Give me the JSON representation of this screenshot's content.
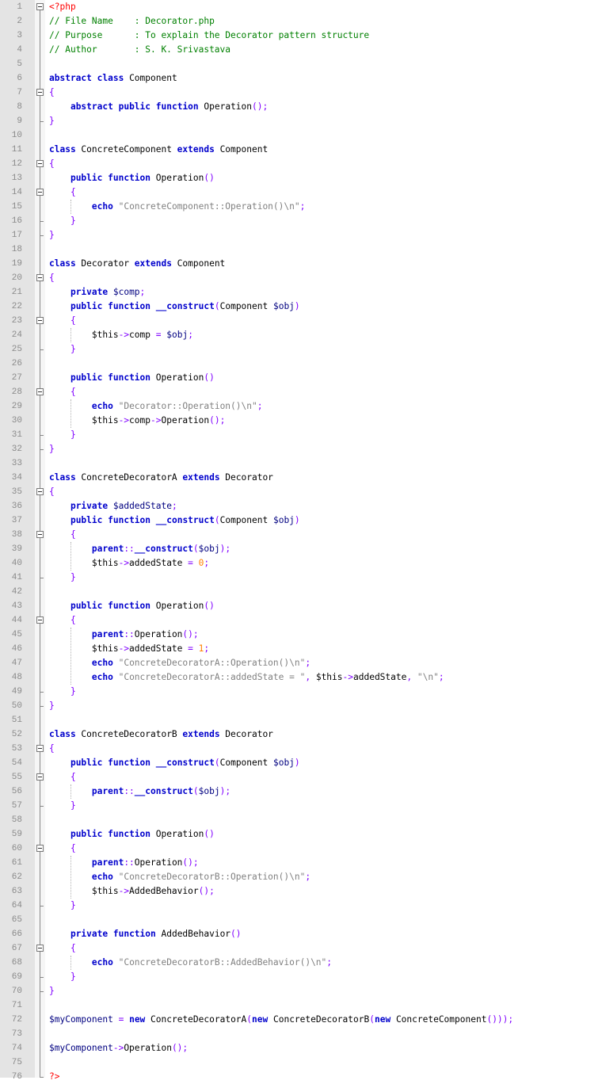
{
  "editor": {
    "language": "php",
    "file_name": "Decorator.php",
    "colors": {
      "keyword": "#0000cc",
      "comment": "#008000",
      "string": "#808080",
      "number": "#ff8000",
      "php_tag": "#ff0000",
      "operator": "#8000ff",
      "variable": "#000080",
      "gutter": "#e4e4e4"
    },
    "lines": [
      "<?php",
      "// File Name    : Decorator.php",
      "// Purpose      : To explain the Decorator pattern structure",
      "// Author       : S. K. Srivastava",
      "",
      "abstract class Component",
      "{",
      "    abstract public function Operation();",
      "}",
      "",
      "class ConcreteComponent extends Component",
      "{",
      "    public function Operation()",
      "    {",
      "        echo \"ConcreteComponent::Operation()\\n\";",
      "    }",
      "}",
      "",
      "class Decorator extends Component",
      "{",
      "    private $comp;",
      "    public function __construct(Component $obj)",
      "    {",
      "        $this->comp = $obj;",
      "    }",
      "",
      "    public function Operation()",
      "    {",
      "        echo \"Decorator::Operation()\\n\";",
      "        $this->comp->Operation();",
      "    }",
      "}",
      "",
      "class ConcreteDecoratorA extends Decorator",
      "{",
      "    private $addedState;",
      "    public function __construct(Component $obj)",
      "    {",
      "        parent::__construct($obj);",
      "        $this->addedState = 0;",
      "    }",
      "",
      "    public function Operation()",
      "    {",
      "        parent::Operation();",
      "        $this->addedState = 1;",
      "        echo \"ConcreteDecoratorA::Operation()\\n\";",
      "        echo \"ConcreteDecoratorA::addedState = \", $this->addedState, \"\\n\";",
      "    }",
      "}",
      "",
      "class ConcreteDecoratorB extends Decorator",
      "{",
      "    public function __construct(Component $obj)",
      "    {",
      "        parent::__construct($obj);",
      "    }",
      "",
      "    public function Operation()",
      "    {",
      "        parent::Operation();",
      "        echo \"ConcreteDecoratorB::Operation()\\n\";",
      "        $this->AddedBehavior();",
      "    }",
      "",
      "    private function AddedBehavior()",
      "    {",
      "        echo \"ConcreteDecoratorB::AddedBehavior()\\n\";",
      "    }",
      "}",
      "",
      "$myComponent = new ConcreteDecoratorA(new ConcreteDecoratorB(new ConcreteComponent()));",
      "",
      "$myComponent->Operation();",
      "",
      "?>"
    ],
    "fold_blocks": [
      [
        1,
        76
      ],
      [
        7,
        9
      ],
      [
        12,
        17
      ],
      [
        14,
        16
      ],
      [
        20,
        32
      ],
      [
        23,
        25
      ],
      [
        28,
        31
      ],
      [
        35,
        50
      ],
      [
        38,
        41
      ],
      [
        44,
        49
      ],
      [
        53,
        70
      ],
      [
        55,
        57
      ],
      [
        60,
        64
      ],
      [
        67,
        69
      ]
    ]
  }
}
